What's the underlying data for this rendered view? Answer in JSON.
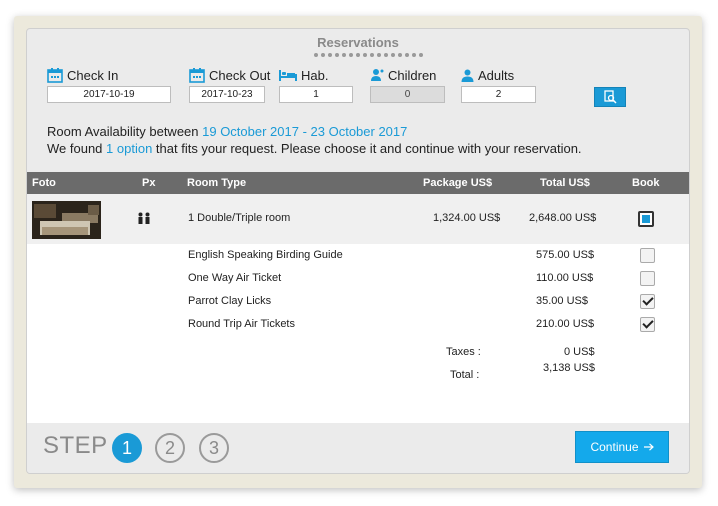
{
  "header": {
    "title": "Reservations"
  },
  "form": {
    "check_in": {
      "label": "Check In",
      "value": "2017-10-19"
    },
    "check_out": {
      "label": "Check Out",
      "value": "2017-10-23"
    },
    "hab": {
      "label": "Hab.",
      "value": "1"
    },
    "children": {
      "label": "Children",
      "value": "0"
    },
    "adults": {
      "label": "Adults",
      "value": "2"
    }
  },
  "availability": {
    "prefix": "Room Availability between ",
    "range": "19 October 2017 - 23 October 2017",
    "found_prefix": "We found ",
    "found_count": "1 option",
    "found_suffix": " that fits your request. Please choose it and continue with your reservation."
  },
  "table": {
    "headers": {
      "foto": "Foto",
      "px": "Px",
      "room_type": "Room Type",
      "package": "Package US$",
      "total": "Total US$",
      "book": "Book"
    },
    "room": {
      "type": "1 Double/Triple room",
      "package": "1,324.00 US$",
      "total": "2,648.00 US$",
      "booked": true
    },
    "extras": [
      {
        "name": "English Speaking Birding Guide",
        "price": "575.00 US$",
        "checked": false
      },
      {
        "name": "One Way Air Ticket",
        "price": "110.00 US$",
        "checked": false
      },
      {
        "name": "Parrot Clay Licks",
        "price": "35.00 US$",
        "checked": true
      },
      {
        "name": "Round Trip Air Tickets",
        "price": "210.00 US$",
        "checked": true
      }
    ],
    "taxes_label": "Taxes :",
    "taxes_value": "0 US$",
    "total_label": "Total :",
    "total_value": "3,138 US$"
  },
  "steps": {
    "label": "STEP",
    "items": [
      "1",
      "2",
      "3"
    ],
    "active": 1
  },
  "continue_label": "Continue",
  "colors": {
    "accent": "#1a9ad6",
    "header_bar": "#6b6b6b"
  },
  "icons": [
    "calendar-icon",
    "bed-icon",
    "child-icon",
    "adult-icon",
    "search-icon",
    "people-icon",
    "arrow-right-icon"
  ]
}
